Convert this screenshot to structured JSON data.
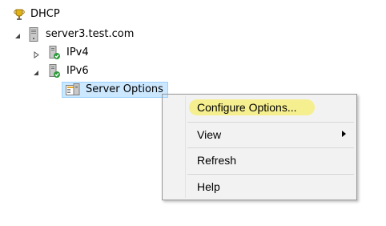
{
  "tree": {
    "root": {
      "label": "DHCP",
      "icon": "dhcp-trophy-icon"
    },
    "server": {
      "label": "server3.test.com",
      "icon": "server-tower-icon",
      "expander": "expanded"
    },
    "ipv4": {
      "label": "IPv4",
      "icon": "network-scope-icon",
      "expander": "collapsed"
    },
    "ipv6": {
      "label": "IPv6",
      "icon": "network-scope-icon",
      "expander": "expanded"
    },
    "server_options": {
      "label": "Server Options",
      "icon": "server-options-icon",
      "selected": true
    }
  },
  "context_menu": {
    "items": [
      {
        "label": "Configure Options...",
        "highlighted": true
      },
      {
        "label": "View",
        "has_submenu": true
      },
      {
        "label": "Refresh"
      },
      {
        "label": "Help"
      }
    ]
  },
  "colors": {
    "selection": "#cce8ff",
    "highlight_marker": "#f6ef8f"
  }
}
